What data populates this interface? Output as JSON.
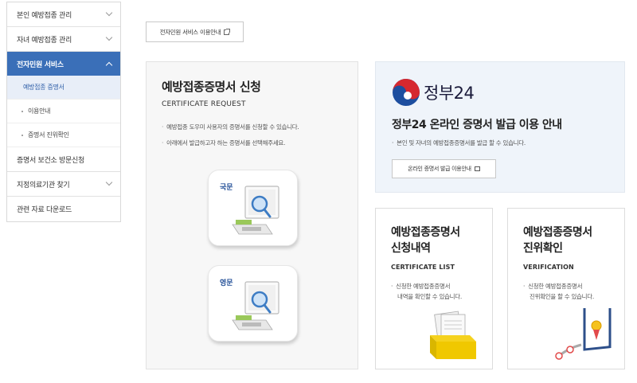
{
  "sidebar": {
    "items": [
      {
        "label": "본인 예방접종 관리",
        "expanded": false
      },
      {
        "label": "자녀 예방접종 관리",
        "expanded": false
      },
      {
        "label": "전자민원 서비스",
        "expanded": true,
        "children": [
          "예방접종 증명서",
          "이용안내",
          "증명서 진위확인"
        ]
      },
      {
        "label": "증명서 보건소 방문신청"
      },
      {
        "label": "지정의료기관 찾기",
        "expanded": false
      },
      {
        "label": "관련 자료 다운로드"
      }
    ]
  },
  "guide_button": {
    "label": "전자민원 서비스 이용안내",
    "icon": "external-link-icon"
  },
  "request": {
    "title": "예방접종증명서 신청",
    "subtitle": "CERTIFICATE REQUEST",
    "notes": [
      "예방접종 도우미 사용자의 증명서를 신청할 수 있습니다.",
      "아래에서 발급하고자 하는 증명서를 선택해주세요."
    ],
    "korean": "국문",
    "english": "영문"
  },
  "gov24": {
    "brand": "정부24",
    "title": "정부24 온라인 증명서 발급 이용 안내",
    "desc": "본인 및 자녀의 예방접종증명서를 발급 할 수 있습니다.",
    "button": "온라인 증명서 발급 이용안내",
    "colors": {
      "red": "#d6282f",
      "blue": "#1d4e9f"
    }
  },
  "list_card": {
    "title_line1": "예방접종증명서",
    "title_line2": "신청내역",
    "eng": "CERTIFICATE LIST",
    "desc_line1": "신청한 예방접종증명서",
    "desc_line2": "내역을 확인할 수 있습니다."
  },
  "verify_card": {
    "title_line1": "예방접종증명서",
    "title_line2": "진위확인",
    "eng": "VERIFICATION",
    "desc_line1": "신청한 예방접종증명서",
    "desc_line2": "진위확인을 할 수 있습니다."
  }
}
